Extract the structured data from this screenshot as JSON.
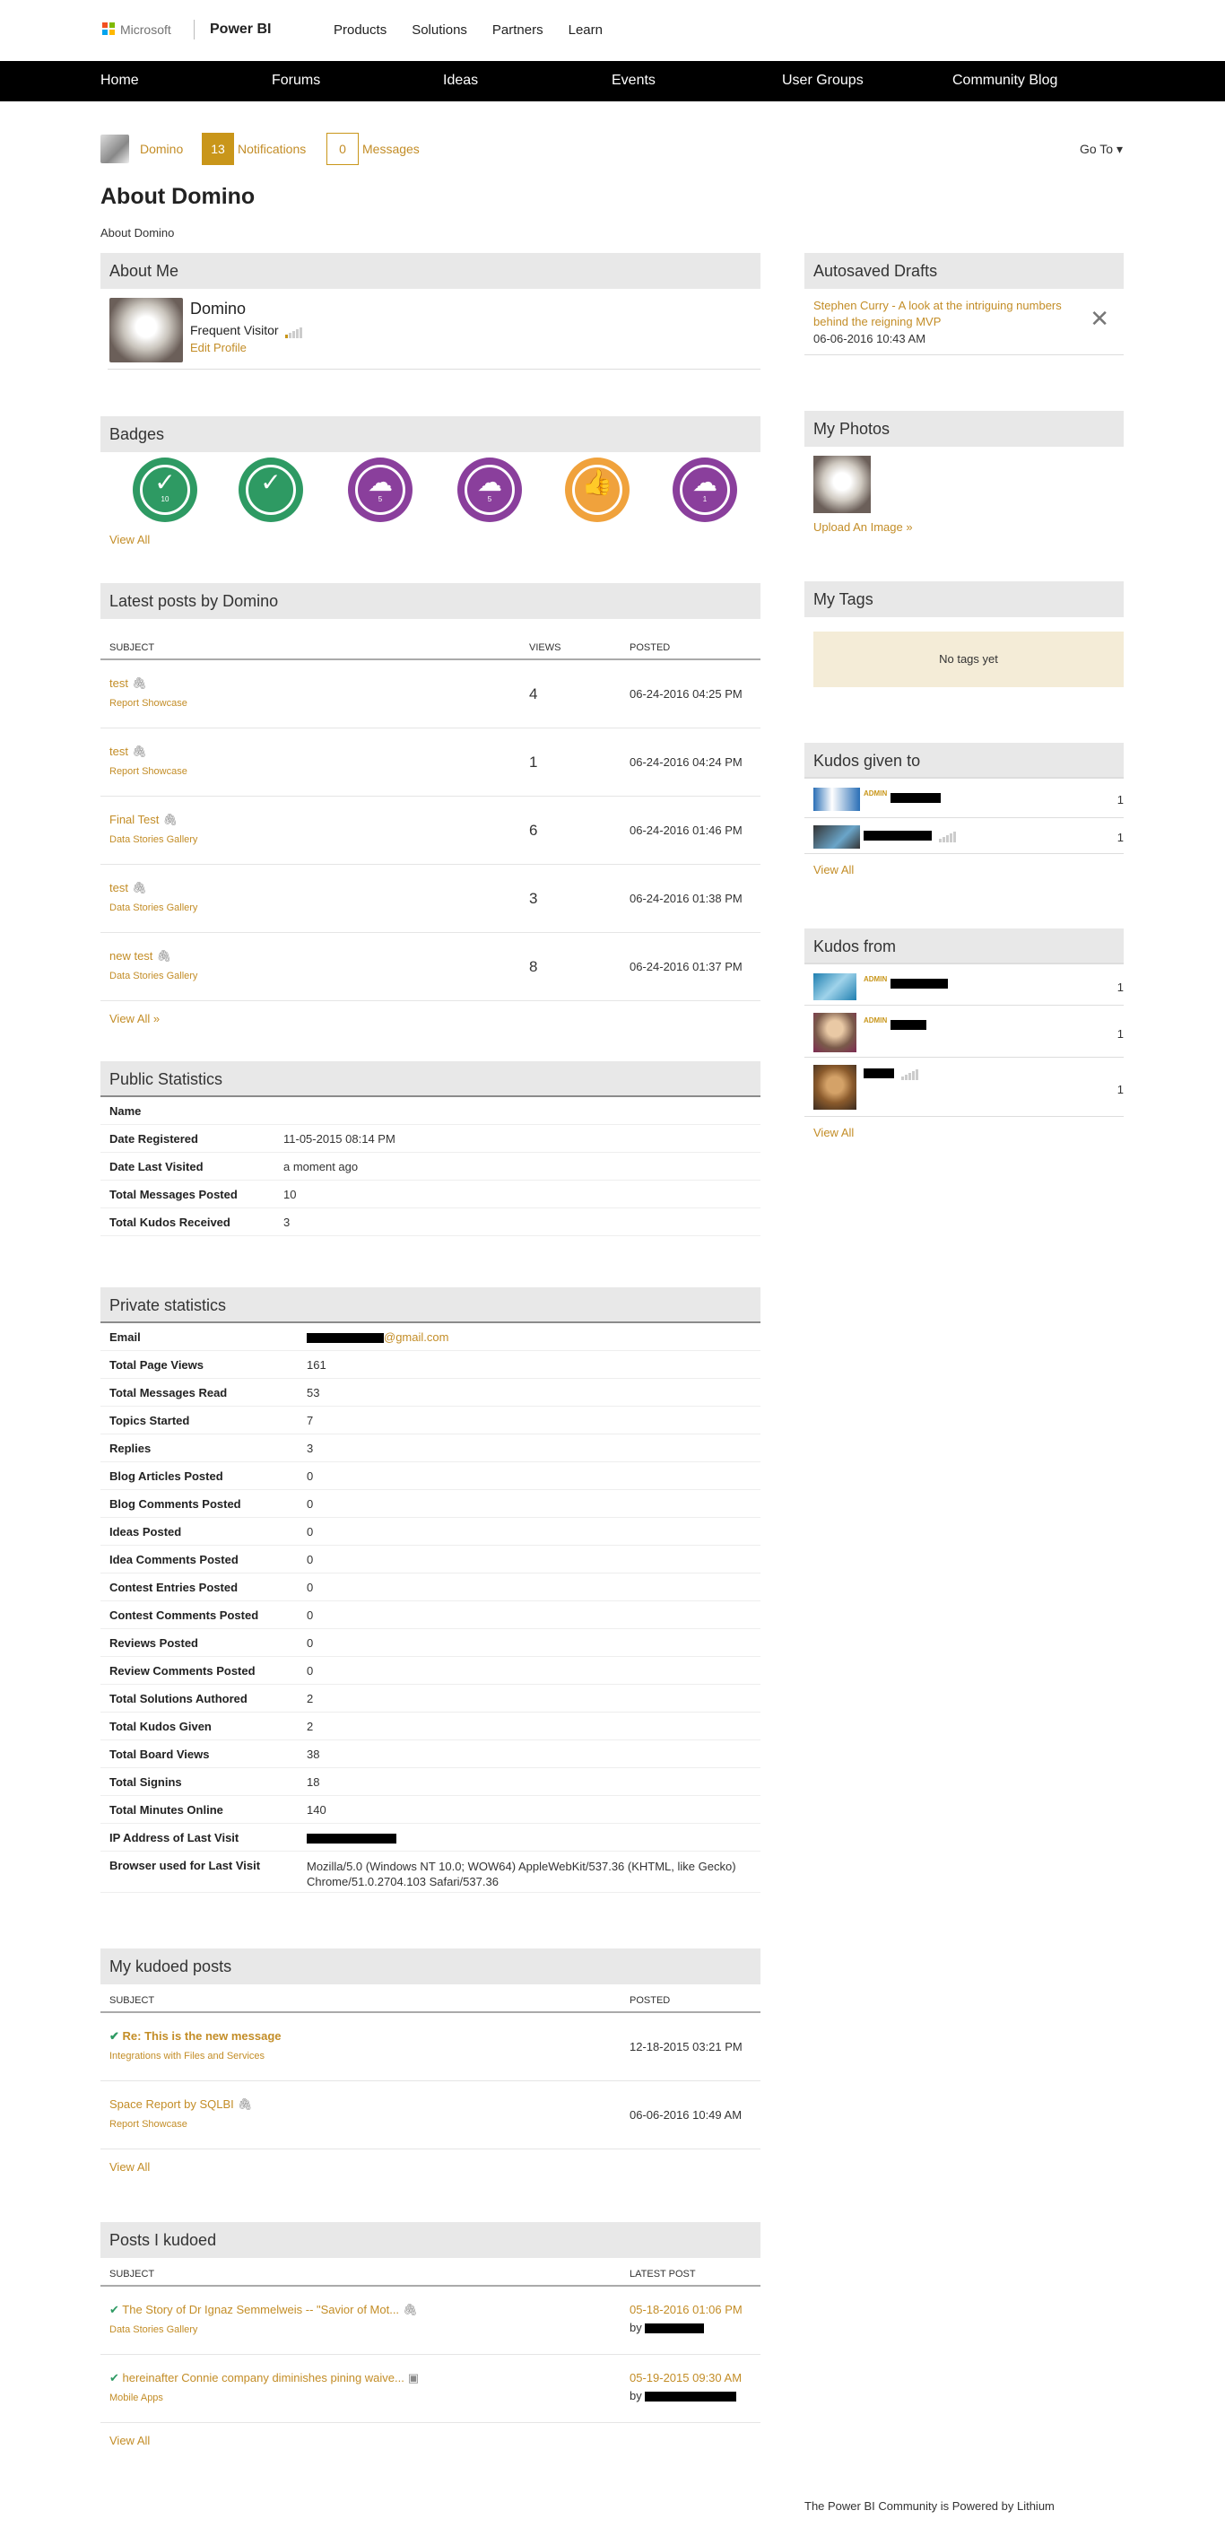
{
  "header": {
    "ms_text": "Microsoft",
    "product": "Power BI",
    "top_links": [
      "Products",
      "Solutions",
      "Partners",
      "Learn"
    ]
  },
  "nav": [
    "Home",
    "Forums",
    "Ideas",
    "Events",
    "User Groups",
    "Community Blog"
  ],
  "userbar": {
    "name": "Domino",
    "notif_count": "13",
    "notif_label": "Notifications",
    "msg_count": "0",
    "msg_label": "Messages",
    "goto": "Go To"
  },
  "page": {
    "title": "About Domino",
    "breadcrumb": "About Domino"
  },
  "about": {
    "heading": "About Me",
    "name": "Domino",
    "rank": "Frequent Visitor",
    "edit": "Edit Profile",
    "rank_level": 1
  },
  "badges": {
    "heading": "Badges",
    "items": [
      {
        "icon": "check-icon",
        "color": "#2e9a63",
        "label": "10"
      },
      {
        "icon": "check-icon",
        "color": "#2e9a63",
        "label": ""
      },
      {
        "icon": "cloud-icon",
        "color": "#8a3f9c",
        "label": "5"
      },
      {
        "icon": "cloud-icon",
        "color": "#8a3f9c",
        "label": "5"
      },
      {
        "icon": "thumbs-up-icon",
        "color": "#f0a23c",
        "label": ""
      },
      {
        "icon": "cloud-icon",
        "color": "#8a3f9c",
        "label": "1"
      }
    ],
    "view_all": "View All"
  },
  "latest": {
    "heading": "Latest posts by Domino",
    "col_subject": "SUBJECT",
    "col_views": "VIEWS",
    "col_posted": "POSTED",
    "rows": [
      {
        "subject": "test",
        "board": "Report Showcase",
        "views": "4",
        "posted": "06-24-2016 04:25 PM"
      },
      {
        "subject": "test",
        "board": "Report Showcase",
        "views": "1",
        "posted": "06-24-2016 04:24 PM"
      },
      {
        "subject": "Final Test",
        "board": "Data Stories Gallery",
        "views": "6",
        "posted": "06-24-2016 01:46 PM"
      },
      {
        "subject": "test",
        "board": "Data Stories Gallery",
        "views": "3",
        "posted": "06-24-2016 01:38 PM"
      },
      {
        "subject": "new test",
        "board": "Data Stories Gallery",
        "views": "8",
        "posted": "06-24-2016 01:37 PM"
      }
    ],
    "view_all": "View All »"
  },
  "public_stats": {
    "heading": "Public Statistics",
    "rows": [
      {
        "k": "Name",
        "v": ""
      },
      {
        "k": "Date Registered",
        "v": "11-05-2015 08:14 PM"
      },
      {
        "k": "Date Last Visited",
        "v": "a moment ago"
      },
      {
        "k": "Total Messages Posted",
        "v": "10"
      },
      {
        "k": "Total Kudos Received",
        "v": "3"
      }
    ]
  },
  "private_stats": {
    "heading": "Private statistics",
    "email_suffix": "@gmail.com",
    "rows": [
      {
        "k": "Email",
        "v": ""
      },
      {
        "k": "Total Page Views",
        "v": "161"
      },
      {
        "k": "Total Messages Read",
        "v": "53"
      },
      {
        "k": "Topics Started",
        "v": "7"
      },
      {
        "k": "Replies",
        "v": "3"
      },
      {
        "k": "Blog Articles Posted",
        "v": "0"
      },
      {
        "k": "Blog Comments Posted",
        "v": "0"
      },
      {
        "k": "Ideas Posted",
        "v": "0"
      },
      {
        "k": "Idea Comments Posted",
        "v": "0"
      },
      {
        "k": "Contest Entries Posted",
        "v": "0"
      },
      {
        "k": "Contest Comments Posted",
        "v": "0"
      },
      {
        "k": "Reviews Posted",
        "v": "0"
      },
      {
        "k": "Review Comments Posted",
        "v": "0"
      },
      {
        "k": "Total Solutions Authored",
        "v": "2"
      },
      {
        "k": "Total Kudos Given",
        "v": "2"
      },
      {
        "k": "Total Board Views",
        "v": "38"
      },
      {
        "k": "Total Signins",
        "v": "18"
      },
      {
        "k": "Total Minutes Online",
        "v": "140"
      },
      {
        "k": "IP Address of Last Visit",
        "v": ""
      }
    ],
    "browser_label": "Browser used for Last Visit",
    "browser_value": "Mozilla/5.0 (Windows NT 10.0; WOW64) AppleWebKit/537.36 (KHTML, like Gecko) Chrome/51.0.2704.103 Safari/537.36"
  },
  "kudoed": {
    "heading": "My kudoed posts",
    "col_subject": "SUBJECT",
    "col_posted": "POSTED",
    "rows": [
      {
        "subject": "Re: This is the new message",
        "board": "Integrations with Files and Services",
        "posted": "12-18-2015 03:21 PM"
      },
      {
        "subject": "Space Report by SQLBI",
        "board": "Report Showcase",
        "posted": "06-06-2016 10:49 AM"
      }
    ],
    "view_all": "View All"
  },
  "ikudoed": {
    "heading": "Posts I kudoed",
    "col_subject": "SUBJECT",
    "col_latest": "LATEST POST",
    "by": "by",
    "rows": [
      {
        "subject": "The Story of Dr Ignaz Semmelweis -- \"Savior of Mot...",
        "board": "Data Stories Gallery",
        "date": "05-18-2016 01:06 PM"
      },
      {
        "subject": "hereinafter Connie company diminishes pining waive...",
        "board": "Mobile Apps",
        "date": "05-19-2015 09:30 AM"
      }
    ],
    "view_all": "View All"
  },
  "drafts": {
    "heading": "Autosaved Drafts",
    "title": "Stephen Curry - A look at the intriguing numbers behind the reigning MVP",
    "date": "06-06-2016 10:43 AM"
  },
  "photos": {
    "heading": "My Photos",
    "upload": "Upload An Image »"
  },
  "tags": {
    "heading": "My Tags",
    "empty": "No tags yet"
  },
  "kudos_to": {
    "heading": "Kudos given to",
    "admin": "ADMIN",
    "counts": [
      "1",
      "1"
    ],
    "view_all": "View All"
  },
  "kudos_from": {
    "heading": "Kudos from",
    "admin": "ADMIN",
    "counts": [
      "1",
      "1",
      "1"
    ],
    "view_all": "View All"
  },
  "footer": "The Power BI Community is Powered by Lithium"
}
